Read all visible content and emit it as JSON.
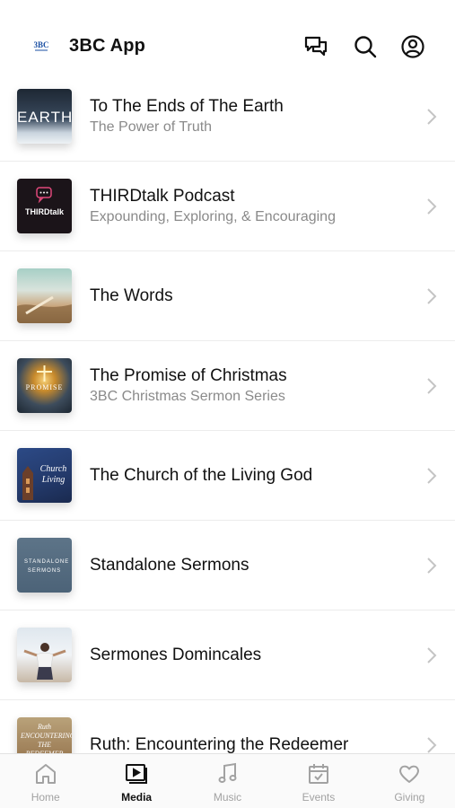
{
  "header": {
    "app_title": "3BC App",
    "logo_text": "3BC"
  },
  "colors": {
    "active": "#111111",
    "inactive": "#a2a2a2",
    "divider": "#ececec"
  },
  "list": [
    {
      "title": "To The Ends of The Earth",
      "subtitle": "The Power of Truth",
      "thumb_text": "EARTH"
    },
    {
      "title": "THIRDtalk Podcast",
      "subtitle": "Expounding, Exploring, & Encouraging",
      "thumb_text": "THIRDtalk"
    },
    {
      "title": "The Words",
      "subtitle": ""
    },
    {
      "title": "The Promise of Christmas",
      "subtitle": "3BC Christmas Sermon Series",
      "thumb_text": "PROMISE"
    },
    {
      "title": "The Church of the Living God",
      "subtitle": "",
      "thumb_text": "Church Living"
    },
    {
      "title": "Standalone Sermons",
      "subtitle": "",
      "thumb_text": "STANDALONE SERMONS"
    },
    {
      "title": "Sermones Domincales",
      "subtitle": ""
    },
    {
      "title": "Ruth: Encountering the Redeemer",
      "subtitle": "",
      "thumb_text": "Ruth ENCOUNTERING THE REDEEMER"
    }
  ],
  "tabs": [
    {
      "label": "Home",
      "icon": "home-icon"
    },
    {
      "label": "Media",
      "icon": "media-icon"
    },
    {
      "label": "Music",
      "icon": "music-icon"
    },
    {
      "label": "Events",
      "icon": "calendar-icon"
    },
    {
      "label": "Giving",
      "icon": "heart-icon"
    }
  ],
  "active_tab": "Media"
}
